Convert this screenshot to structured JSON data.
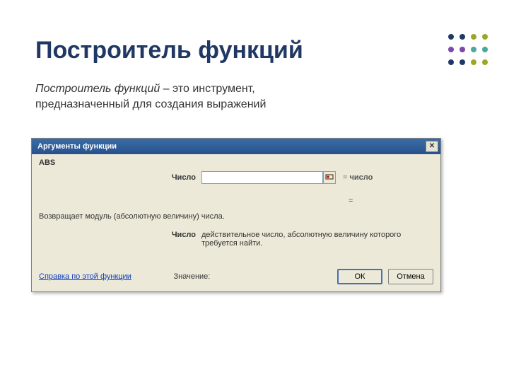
{
  "slide": {
    "heading": "Построитель функций",
    "desc_emph": "Построитель функций",
    "desc_rest": " – это инструмент, предназначенный для создания выражений"
  },
  "dialog": {
    "title": "Аргументы функции",
    "close_icon": "✕",
    "function_name": "ABS",
    "arg": {
      "label": "Число",
      "value": "",
      "eq_sign": "=",
      "eq_value": "число"
    },
    "standalone_eq": "=",
    "description": "Возвращает модуль (абсолютную величину) числа.",
    "arg_help": {
      "label": "Число",
      "text": "действительное число, абсолютную величину которого требуется найти."
    },
    "help_link": "Справка по этой функции",
    "result_label": "Значение:",
    "ok_label": "ОК",
    "cancel_label": "Отмена"
  }
}
